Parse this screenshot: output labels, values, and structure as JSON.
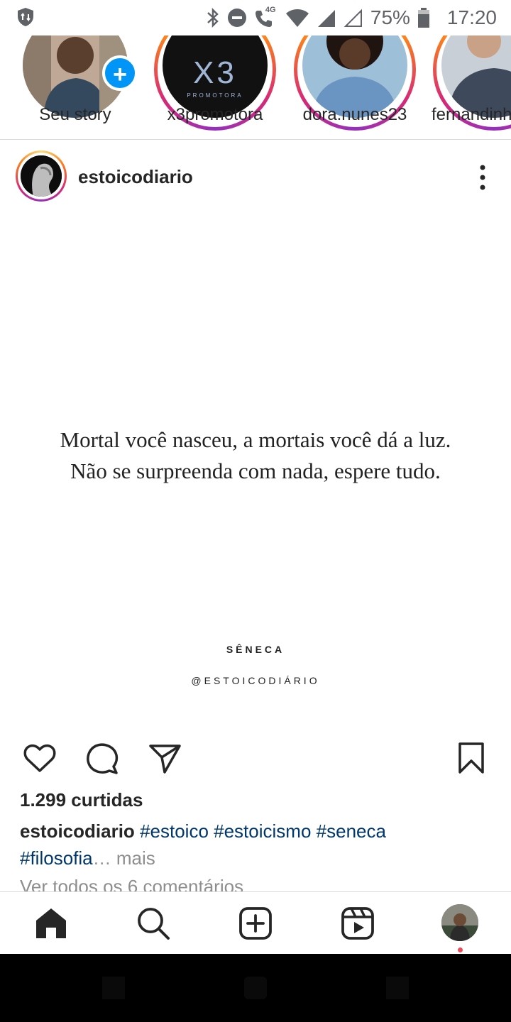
{
  "status_bar": {
    "network_label": "4G",
    "battery": "75%",
    "time": "17:20"
  },
  "stories": [
    {
      "label": "Seu story",
      "is_own": true
    },
    {
      "label": "x3promotora",
      "avatar_text": "X3",
      "avatar_subtext": "PROMOTORA"
    },
    {
      "label": "dora.nunes23"
    },
    {
      "label": "fernandinh"
    }
  ],
  "post": {
    "username": "estoicodiario",
    "image": {
      "quote": "Mortal você nasceu, a mortais você dá a luz. Não se surpreenda com nada, espere tudo.",
      "author": "SÊNECA",
      "handle": "@ESTOICODIÁRIO"
    },
    "likes": "1.299 curtidas",
    "caption": {
      "user": "estoicodiario",
      "hashtags": [
        "#estoico",
        "#estoicismo",
        "#seneca",
        "#filosofia"
      ],
      "ellipsis": "…",
      "more": "mais"
    },
    "comments_link": "Ver todos os 6 comentários"
  },
  "colors": {
    "link": "#00376b",
    "accent_blue": "#0095f6",
    "notification_dot": "#ed4956"
  }
}
